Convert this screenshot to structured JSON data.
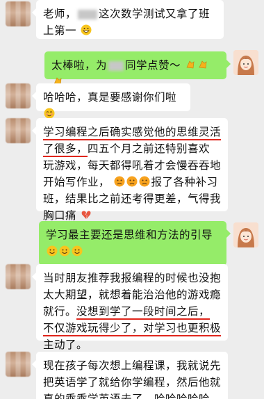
{
  "messages": [
    {
      "side": "left",
      "before": "老师，",
      "after": "这次数学测试又拿了班上第一"
    },
    {
      "side": "right",
      "before": "太棒啦，为",
      "after": "同学点赞～"
    },
    {
      "side": "left",
      "text": "哈哈哈，真是要感谢你们啦"
    },
    {
      "side": "left",
      "part1": "学习编程之后确实感觉他的思维灵活了很多，",
      "part2": "四五个月之前还特别喜欢玩游戏，每天都得吼着才会慢吞吞地开始写作业，",
      "part3": "报了各种补习班，结果比之前还考得更差，气得我胸口痛"
    },
    {
      "side": "right",
      "text": "学习最主要还是思维和方法的引导"
    },
    {
      "side": "left",
      "part1": "当时朋友推荐我报编程的时候也没抱太大期望，就想着能治治他的游戏瘾就行。",
      "part2": "没想到学了一段时间之后，不仅游戏玩得少了，对学习也更积极主动了。"
    },
    {
      "side": "left",
      "text": "现在孩子每次想上编程课，我就说先把英语学了就给你学编程，然后他就真的乖乖学英语去了，哈哈哈哈哈，"
    }
  ],
  "icons": {
    "grin": "grinning-face-icon",
    "clap": "clapping-hands-icon",
    "blush": "smiling-face-icon",
    "sad": "sad-face-icon",
    "broken_heart": "broken-heart-icon"
  },
  "colors": {
    "background": "#ededed",
    "bubble_self": "#95ec69",
    "bubble_other": "#ffffff",
    "underline": "#e0251b"
  }
}
